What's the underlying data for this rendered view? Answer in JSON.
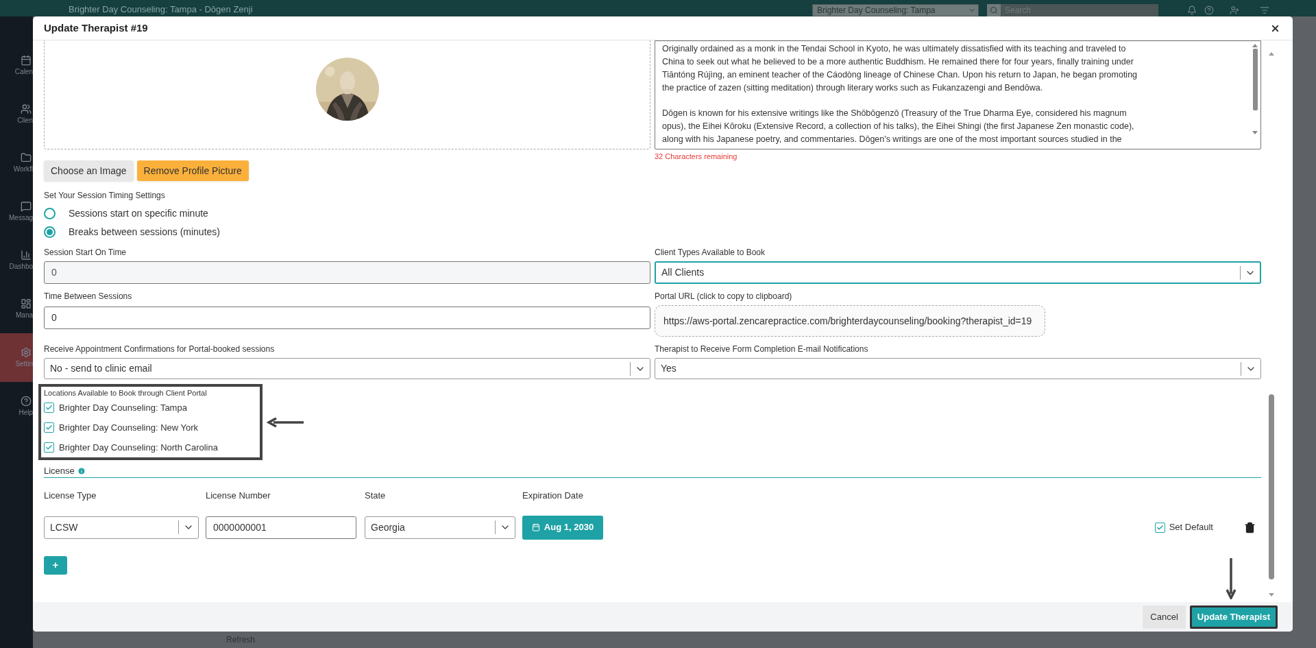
{
  "app": {
    "title": "Brighter Day Counseling: Tampa - Dōgen Zenji",
    "location_select": "Brighter Day Counseling: Tampa",
    "search": {
      "placeholder": "Search"
    },
    "sidebar": [
      {
        "label": "Calen",
        "selected": false
      },
      {
        "label": "Clien",
        "selected": false
      },
      {
        "label": "Workfl",
        "selected": false
      },
      {
        "label": "Messag",
        "selected": false
      },
      {
        "label": "Dashbo",
        "selected": false
      },
      {
        "label": "Mana",
        "selected": false
      },
      {
        "label": "Settin",
        "selected": true
      },
      {
        "label": "Help",
        "selected": false
      }
    ],
    "footer_link": "Refresh"
  },
  "modal": {
    "title": "Update Therapist #19",
    "bio": {
      "paragraphs": [
        [
          "Originally ordained as a monk in the Tendai School in Kyoto, he was ultimately dissatisfied with its teaching and traveled to",
          "China to seek out what he believed to be a more authentic Buddhism. He remained there for four years, finally training under",
          "Tiāntóng Rújìng, an eminent teacher of the Cáodòng lineage of Chinese Chan. Upon his return to Japan, he began promoting",
          "the practice of zazen (sitting meditation) through literary works such as Fukanzazengi and Bendōwa."
        ],
        [
          "Dōgen is known for his extensive writings like the Shōbōgenzō (Treasury of the True Dharma Eye, considered his magnum",
          "opus), the Eihei Kōroku (Extensive Record, a collection of his talks), the Eihei Shingi (the first Japanese Zen monastic code),",
          "along with his Japanese poetry, and commentaries. Dōgen's writings are one of the most important sources studied in the"
        ]
      ],
      "counter": "32 Characters remaining"
    },
    "image_buttons": [
      {
        "label": "Choose an Image",
        "kind": "secondary"
      },
      {
        "label": "Remove Profile Picture",
        "kind": "warning"
      }
    ],
    "timing": {
      "label": "Set Your Session Timing Settings",
      "options": [
        {
          "label": "Sessions start on specific minute",
          "selected": false
        },
        {
          "label": "Breaks between sessions (minutes)",
          "selected": true
        }
      ]
    },
    "session_start": {
      "label": "Session Start On Time",
      "value": "0",
      "disabled": true
    },
    "client_types": {
      "label": "Client Types Available to Book",
      "value": "All Clients",
      "focused": true
    },
    "time_between": {
      "label": "Time Between Sessions",
      "value": "0",
      "disabled": false
    },
    "portal_url": {
      "label": "Portal URL (click to copy to clipboard)",
      "value": "https://aws-portal.zencarepractice.com/brighterdaycounseling/booking?therapist_id=19"
    },
    "confirmations": {
      "label": "Receive Appointment Confirmations for Portal-booked sessions",
      "value": "No - send to clinic email"
    },
    "form_notifications": {
      "label": "Therapist to Receive Form Completion E-mail Notifications",
      "value": "Yes"
    },
    "locations": {
      "label": "Locations Available to Book through Client Portal",
      "highlighted": true,
      "items": [
        {
          "label": "Brighter Day Counseling: Tampa",
          "checked": true
        },
        {
          "label": "Brighter Day Counseling: New York",
          "checked": true
        },
        {
          "label": "Brighter Day Counseling: North Carolina",
          "checked": true
        }
      ]
    },
    "license": {
      "title": "License",
      "columns": [
        "License Type",
        "License Number",
        "State",
        "Expiration Date"
      ],
      "rows": [
        {
          "type": "LCSW",
          "number": "0000000001",
          "state": "Georgia",
          "expiration": "Aug 1, 2030",
          "default_label": "Set Default",
          "default": true
        }
      ],
      "add_button": "+"
    },
    "buttons": [
      {
        "label": "Cancel",
        "kind": "secondary",
        "highlighted": false
      },
      {
        "label": "Update Therapist",
        "kind": "primary",
        "highlighted": true
      }
    ]
  }
}
